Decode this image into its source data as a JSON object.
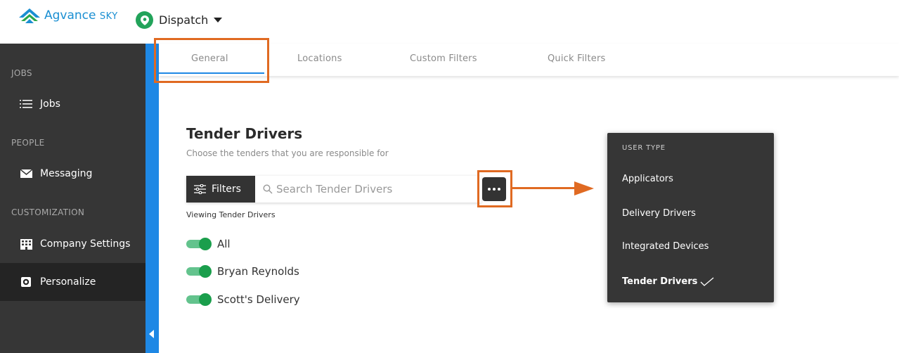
{
  "header": {
    "logo_main": "Agvance",
    "logo_sky": "SKY",
    "module": "Dispatch"
  },
  "sidebar": {
    "sections": [
      {
        "label": "JOBS"
      },
      {
        "label": "PEOPLE"
      },
      {
        "label": "CUSTOMIZATION"
      }
    ],
    "items": [
      {
        "label": "Jobs",
        "icon": "list-icon"
      },
      {
        "label": "Messaging",
        "icon": "envelope-icon"
      },
      {
        "label": "Company Settings",
        "icon": "building-icon"
      },
      {
        "label": "Personalize",
        "icon": "gear-icon",
        "active": true
      }
    ]
  },
  "tabs": [
    {
      "label": "General",
      "active": true
    },
    {
      "label": "Locations"
    },
    {
      "label": "Custom Filters"
    },
    {
      "label": "Quick Filters"
    }
  ],
  "content": {
    "title": "Tender Drivers",
    "subtitle": "Choose the tenders that you are responsible for",
    "filters_label": "Filters",
    "search_placeholder": "Search Tender Drivers",
    "viewing_label": "Viewing Tender Drivers",
    "toggles": [
      {
        "label": "All",
        "on": true
      },
      {
        "label": "Bryan Reynolds",
        "on": true
      },
      {
        "label": "Scott's Delivery",
        "on": true
      }
    ]
  },
  "dropdown": {
    "header": "USER TYPE",
    "items": [
      {
        "label": "Applicators"
      },
      {
        "label": "Delivery Drivers"
      },
      {
        "label": "Integrated Devices"
      },
      {
        "label": "Tender Drivers",
        "selected": true
      }
    ]
  },
  "colors": {
    "accent_blue": "#1e88e5",
    "annotation_orange": "#e06a22",
    "toggle_green": "#1a9e4c",
    "sidebar_bg": "#363636"
  }
}
